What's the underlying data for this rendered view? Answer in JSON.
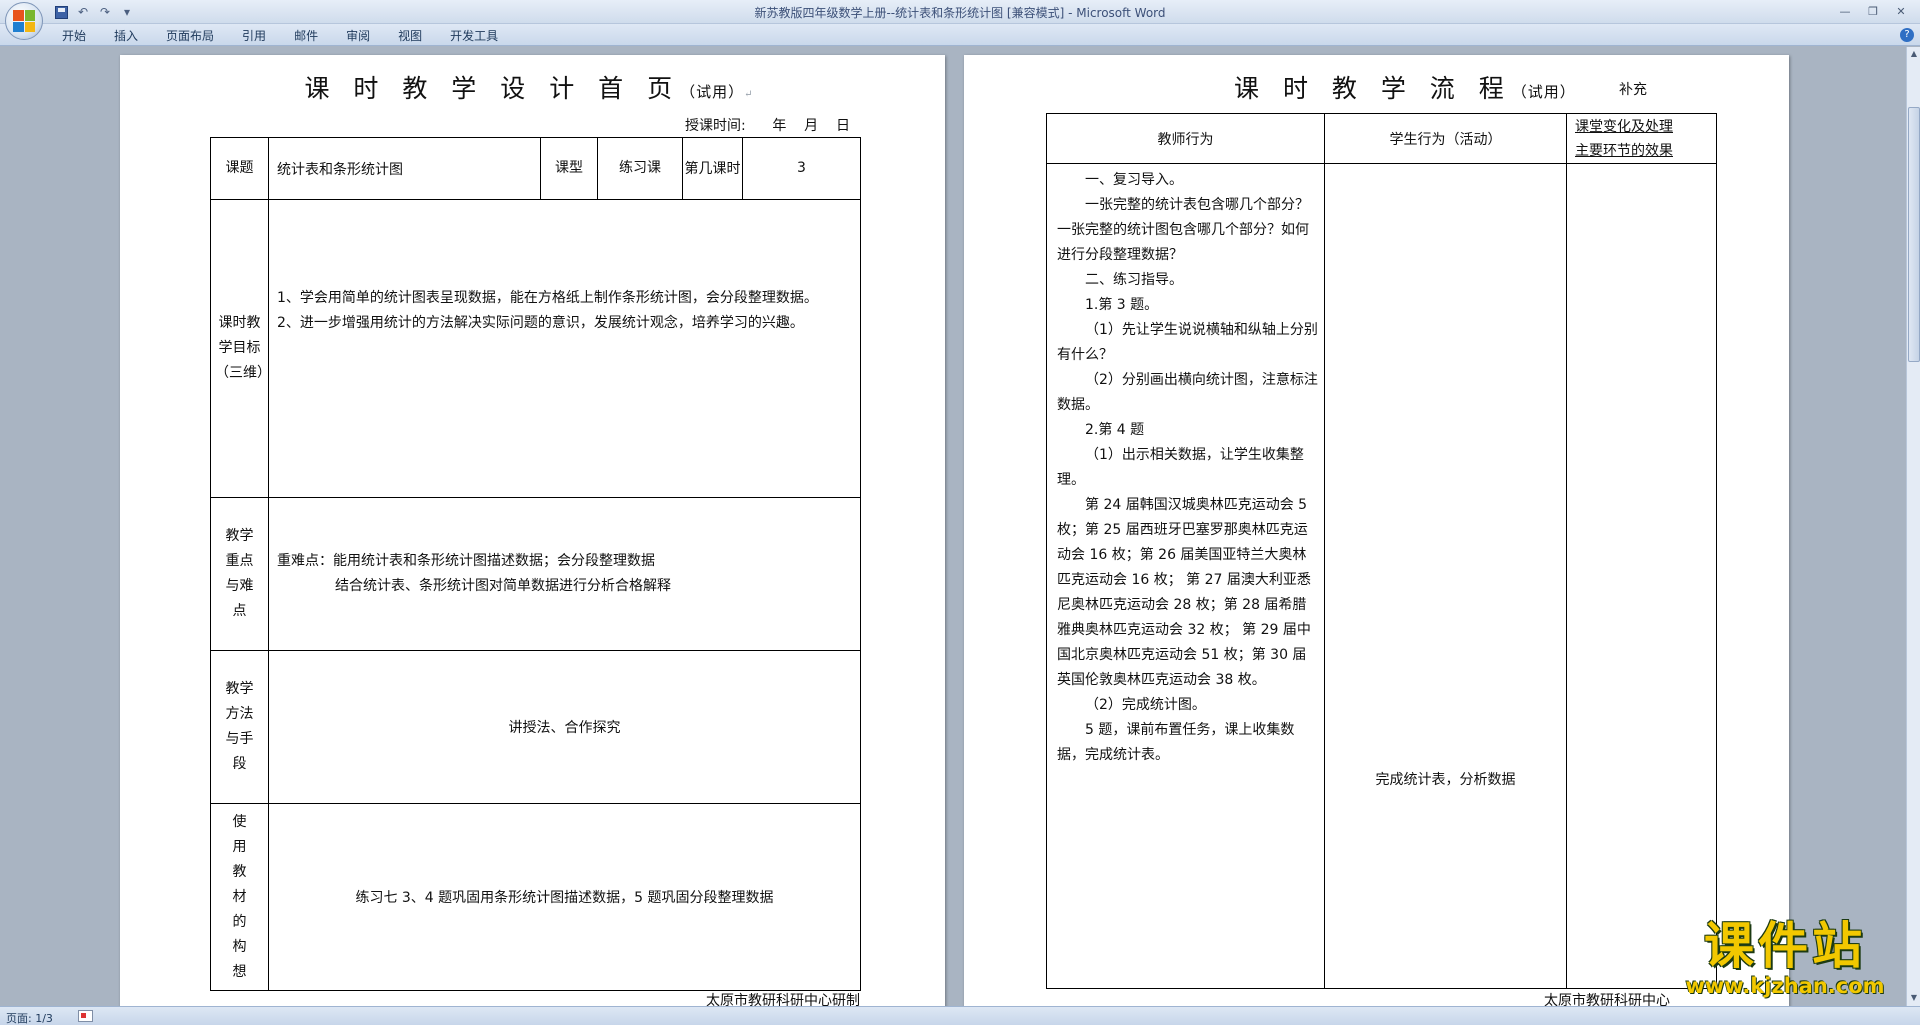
{
  "window": {
    "title": "新苏教版四年级数学上册--统计表和条形统计图 [兼容模式] - Microsoft Word",
    "controls": [
      "—",
      "❐",
      "✕"
    ]
  },
  "ribbon": {
    "tabs": [
      "开始",
      "插入",
      "页面布局",
      "引用",
      "邮件",
      "审阅",
      "视图",
      "开发工具"
    ]
  },
  "page1": {
    "title": "课 时 教 学 设 计 首 页",
    "title_suffix": "（试用）",
    "date_line": "授课时间:      年    月    日",
    "header_row": {
      "topic_label": "课题",
      "topic_value": "统计表和条形统计图",
      "type_label": "课型",
      "type_value": "练习课",
      "period_label": "第几课时",
      "period_value": "3"
    },
    "objectives_label": "课时教学目标（三维）",
    "objectives": [
      "1、学会用简单的统计图表呈现数据，能在方格纸上制作条形统计图，会分段整理数据。",
      "2、进一步增强用统计的方法解决实际问题的意识，发展统计观念，培养学习的兴趣。"
    ],
    "key_label": "教学重点与难点",
    "key_lines": [
      "重难点：能用统计表和条形统计图描述数据；会分段整理数据",
      "结合统计表、条形统计图对简单数据进行分析合格解释"
    ],
    "method_label": "教学方法与手段",
    "method_value": "讲授法、合作探究",
    "material_label": "使用教材的构想",
    "material_value": "练习七 3、4 题巩固用条形统计图描述数据，5 题巩固分段整理数据",
    "footer": "太原市教研科研中心研制"
  },
  "page2": {
    "title": "课 时 教 学 流 程",
    "title_suffix": "（试用）",
    "extra": "补充",
    "col_teacher": "教师行为",
    "col_student": "学生行为（活动）",
    "col_notes_1": "课堂变化及处理",
    "col_notes_2": "主要环节的效果",
    "teacher_paragraphs": [
      "一、复习导入。",
      "一张完整的统计表包含哪几个部分？一张完整的统计图包含哪几个部分？如何进行分段整理数据？",
      "二、练习指导。",
      "1.第 3 题。",
      "（1）先让学生说说横轴和纵轴上分别有什么？",
      "（2）分别画出横向统计图，注意标注数据。",
      "2.第 4 题",
      "（1）出示相关数据，让学生收集整理。",
      "第 24 届韩国汉城奥林匹克运动会 5 枚；第 25 届西班牙巴塞罗那奥林匹克运动会 16 枚；第 26 届美国亚特兰大奥林匹克运动会 16 枚； 第 27 届澳大利亚悉尼奥林匹克运动会 28 枚；第 28 届希腊雅典奥林匹克运动会 32 枚； 第 29 届中国北京奥林匹克运动会 51 枚；第 30 届英国伦敦奥林匹克运动会 38 枚。",
      "（2）完成统计图。",
      "5 题，课前布置任务，课上收集数据，完成统计表。"
    ],
    "student_activity": "完成统计表，分析数据",
    "footer": "太原市教研科研中心"
  },
  "status": {
    "page": "页面: 1/3"
  },
  "watermark": {
    "main": "课件站",
    "url": "www.kjzhan.com"
  }
}
